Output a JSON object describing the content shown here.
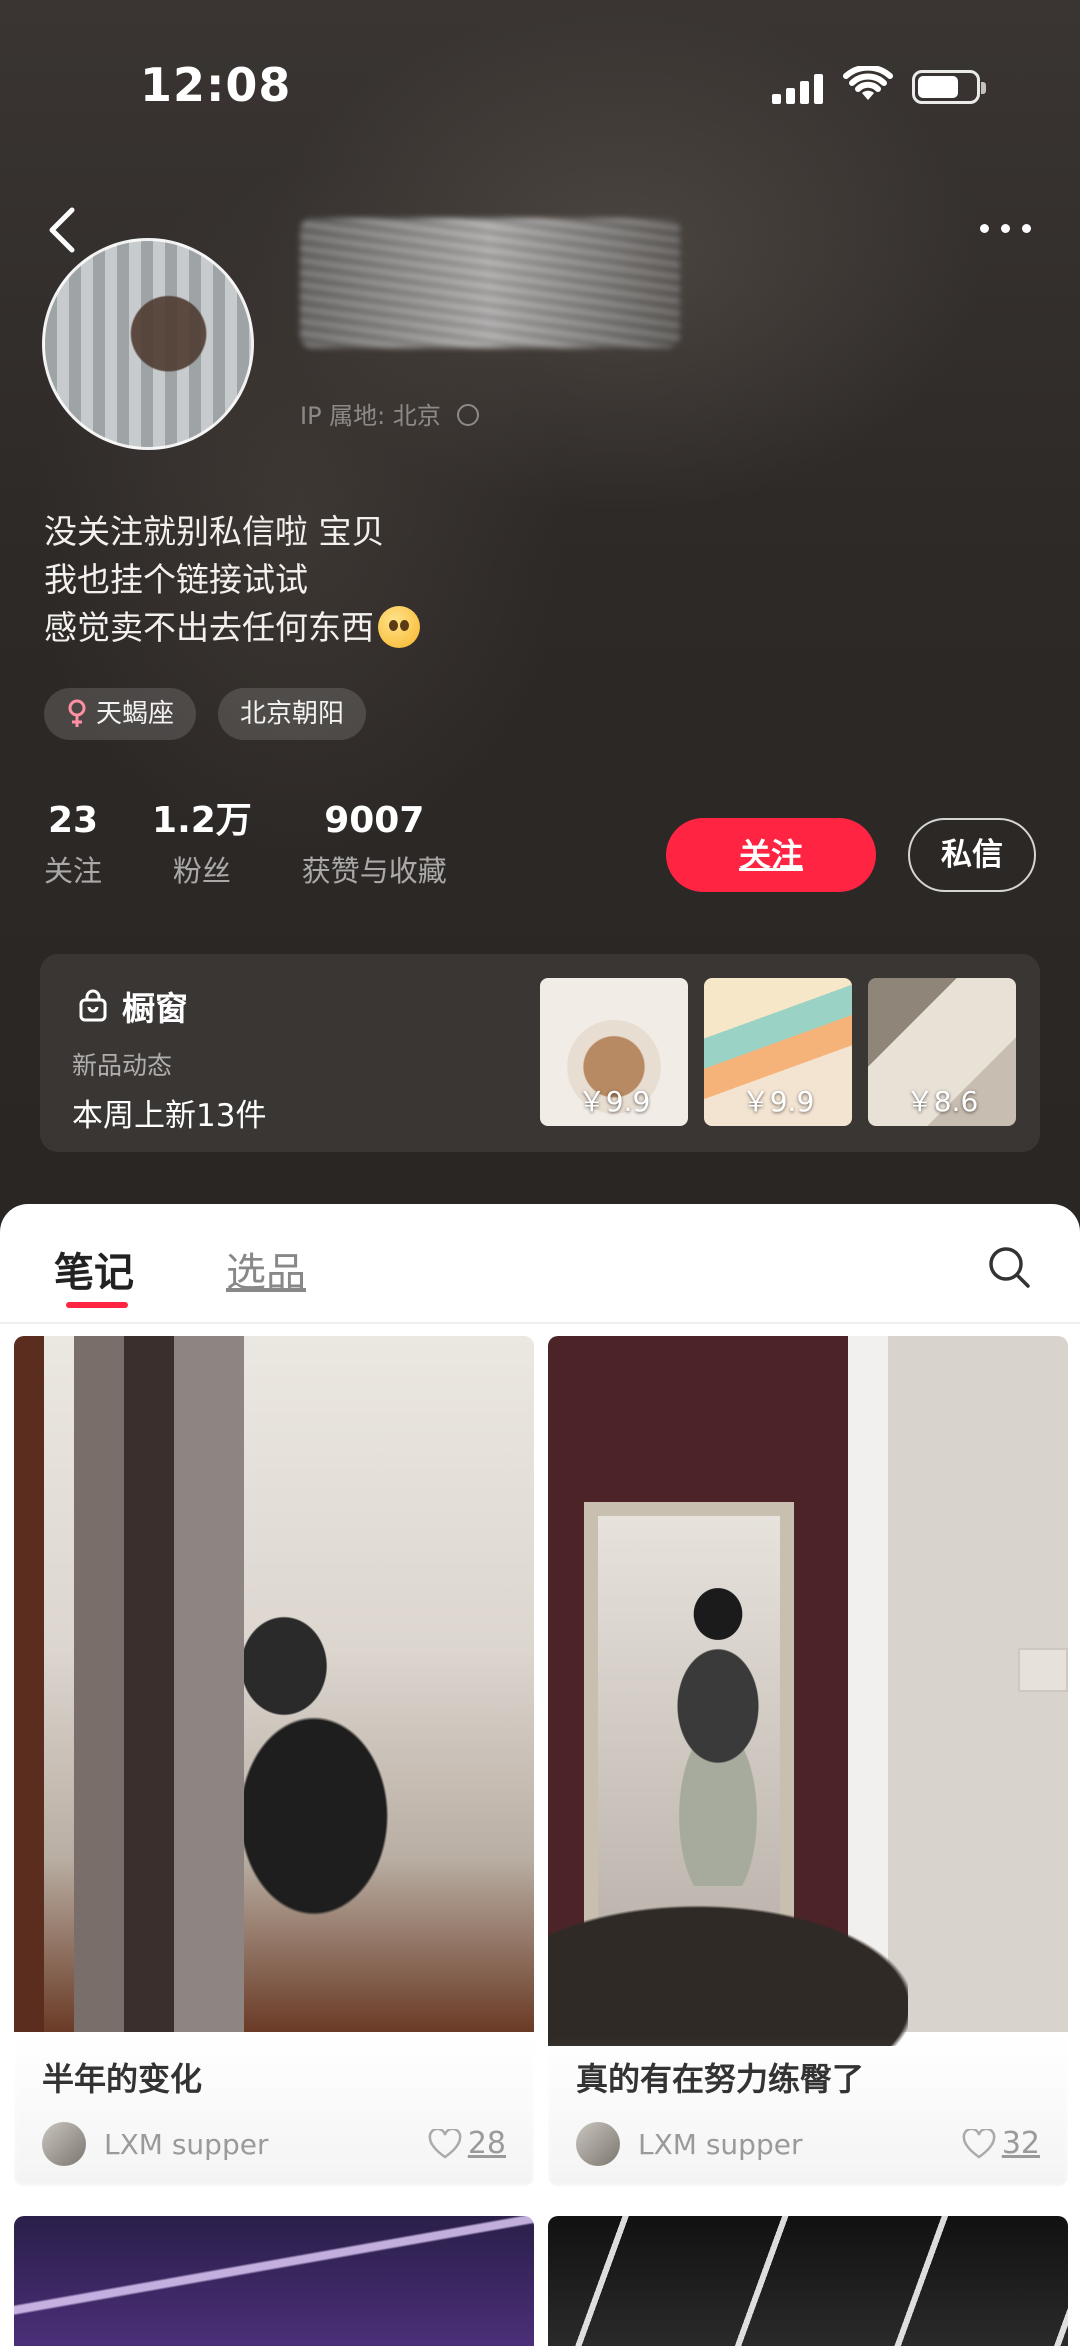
{
  "status_bar": {
    "time": "12:08"
  },
  "profile": {
    "ip_location": "IP 属地: 北京",
    "bio": [
      "没关注就别私信啦 宝贝",
      "我也挂个链接试试",
      "感觉卖不出去任何东西"
    ],
    "tags": [
      {
        "label": "天蝎座",
        "icon": "female-icon"
      },
      {
        "label": "北京朝阳"
      }
    ],
    "stats": [
      {
        "value": "23",
        "label": "关注"
      },
      {
        "value": "1.2万",
        "label": "粉丝"
      },
      {
        "value": "9007",
        "label": "获赞与收藏"
      }
    ],
    "follow_label": "关注",
    "message_label": "私信"
  },
  "showcase": {
    "title": "橱窗",
    "subtitle": "新品动态",
    "new_items": "本周上新13件",
    "products": [
      {
        "price": "￥9.9"
      },
      {
        "price": "￥9.9"
      },
      {
        "price": "￥8.6"
      }
    ]
  },
  "tabs": {
    "notes": "笔记",
    "products": "选品"
  },
  "notes": [
    {
      "title": "半年的变化",
      "author": "LXM supper",
      "likes": "28"
    },
    {
      "title": "真的有在努力练臀了",
      "author": "LXM supper",
      "likes": "32"
    }
  ],
  "colors": {
    "accent": "#ff2442",
    "header_bg": "#2a2624"
  }
}
